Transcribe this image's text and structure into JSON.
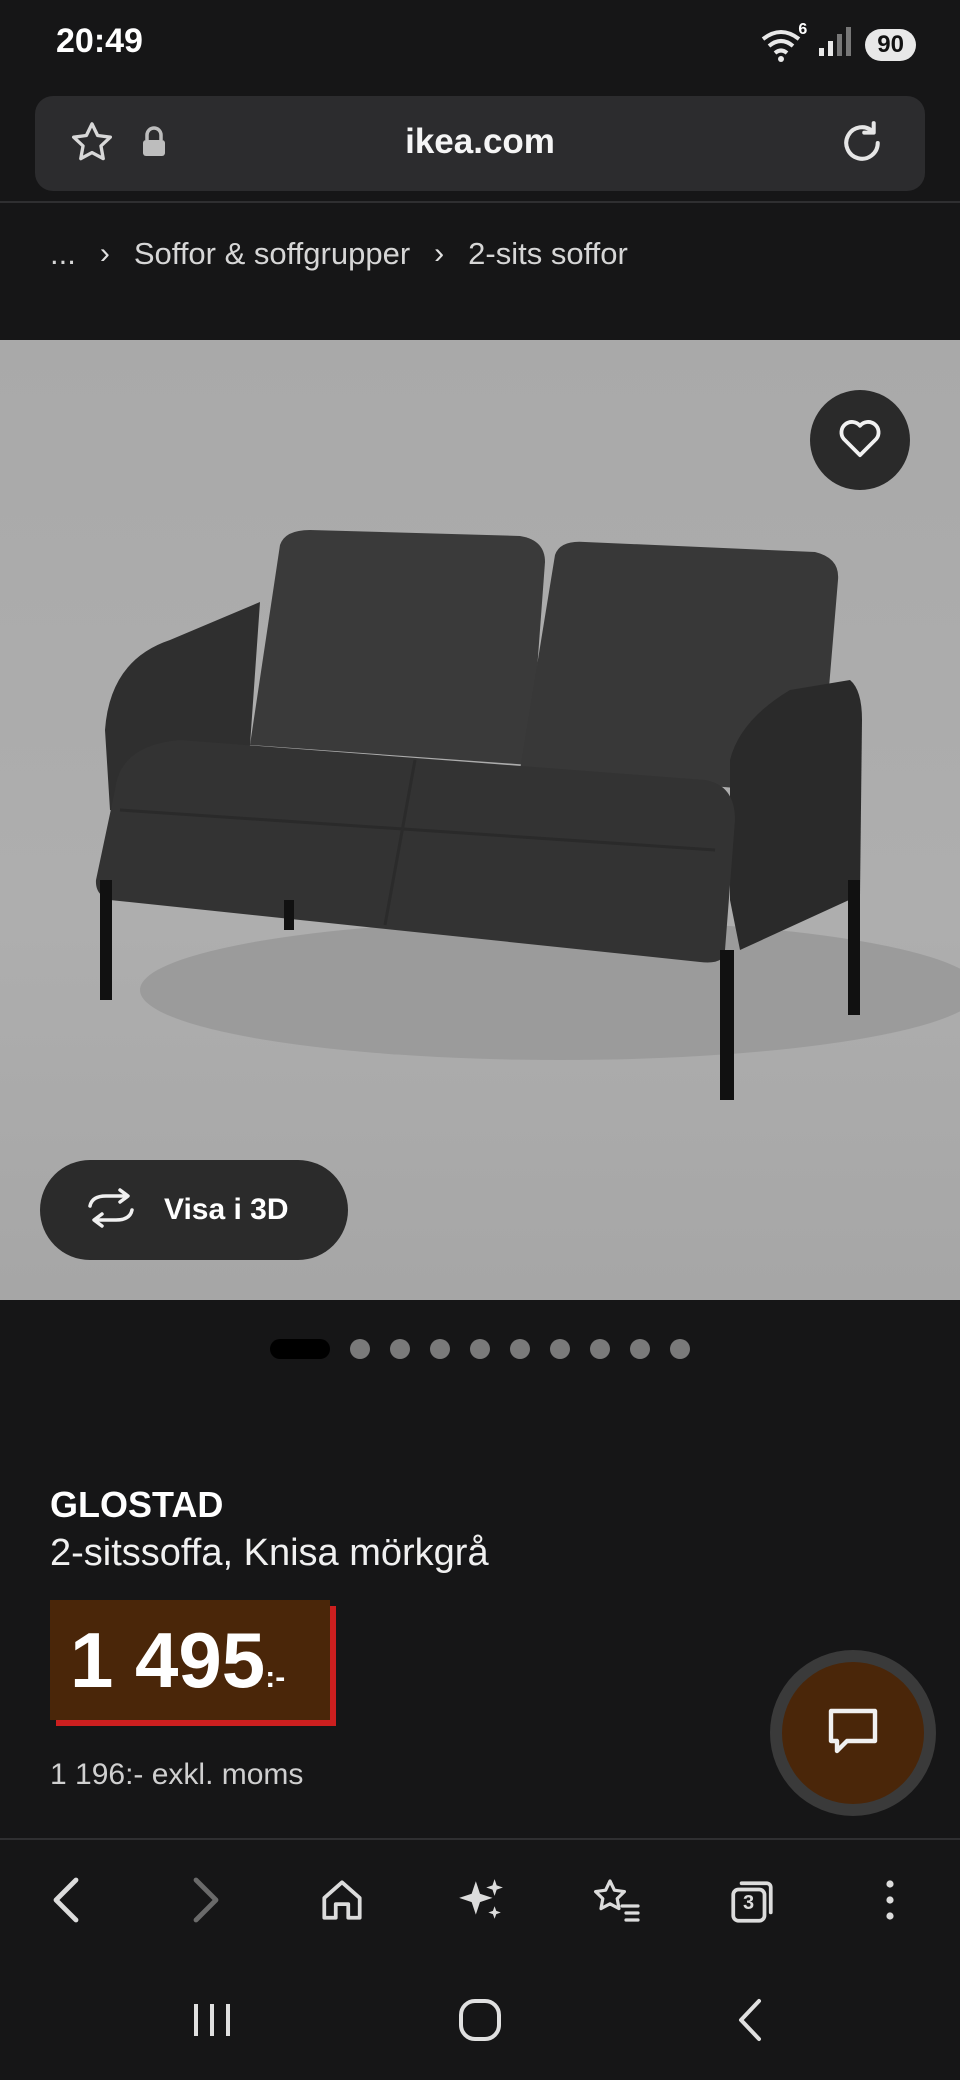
{
  "status_bar": {
    "time": "20:49",
    "battery": "90",
    "wifi_badge": "6"
  },
  "address_bar": {
    "url": "ikea.com"
  },
  "breadcrumb": {
    "ellipsis": "...",
    "items": [
      "Soffor & soffgrupper",
      "2-sits soffor"
    ]
  },
  "gallery": {
    "view_3d_label": "Visa i 3D",
    "total_images": 10,
    "active_index": 0
  },
  "product": {
    "name": "GLOSTAD",
    "description": "2-sitssoffa, Knisa mörkgrå",
    "price": "1 495",
    "price_suffix": ":-",
    "price_excl_vat": "1 196:- exkl. moms"
  },
  "toolbar": {
    "tab_count": "3"
  },
  "colors": {
    "background": "#161617",
    "price_bg": "#4a2609",
    "price_accent": "#cc1f1f"
  }
}
